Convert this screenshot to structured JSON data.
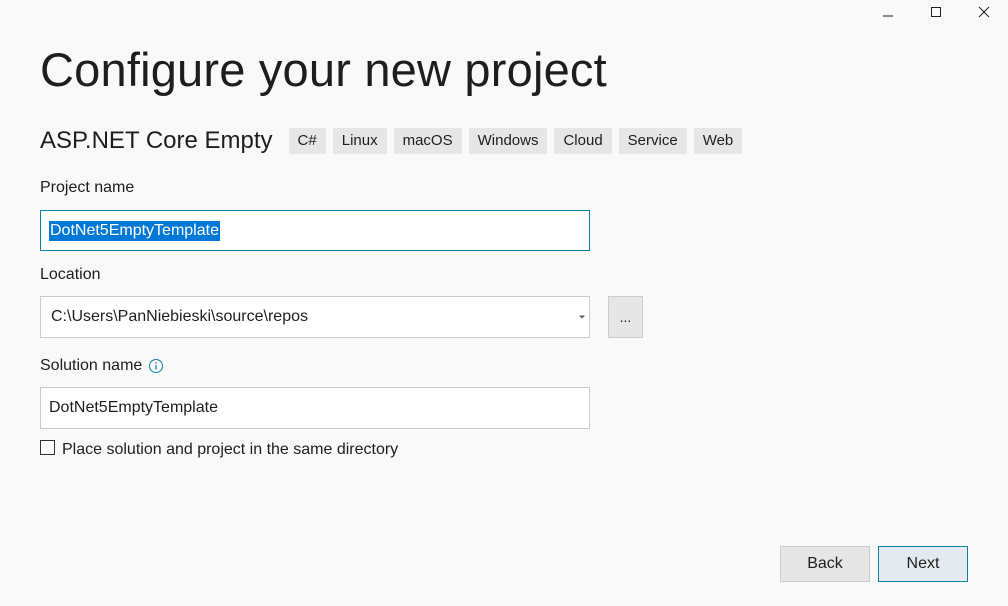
{
  "window_controls": {
    "minimize_icon": "minimize-icon",
    "maximize_icon": "maximize-icon",
    "close_icon": "close-icon"
  },
  "title": "Configure your new project",
  "template": {
    "name": "ASP.NET Core Empty",
    "tags": [
      "C#",
      "Linux",
      "macOS",
      "Windows",
      "Cloud",
      "Service",
      "Web"
    ]
  },
  "project_name": {
    "label": "Project name",
    "value": "DotNet5EmptyTemplate"
  },
  "location": {
    "label": "Location",
    "value": "C:\\Users\\PanNiebieski\\source\\repos",
    "browse_label": "..."
  },
  "solution_name": {
    "label": "Solution name",
    "value": "DotNet5EmptyTemplate",
    "info_icon": "info-icon"
  },
  "same_directory": {
    "label": "Place solution and project in the same directory",
    "checked": false
  },
  "buttons": {
    "back": "Back",
    "next": "Next"
  },
  "colors": {
    "accent": "#0f7fa8",
    "selection": "#0078d7",
    "background": "#f9f9f9"
  }
}
